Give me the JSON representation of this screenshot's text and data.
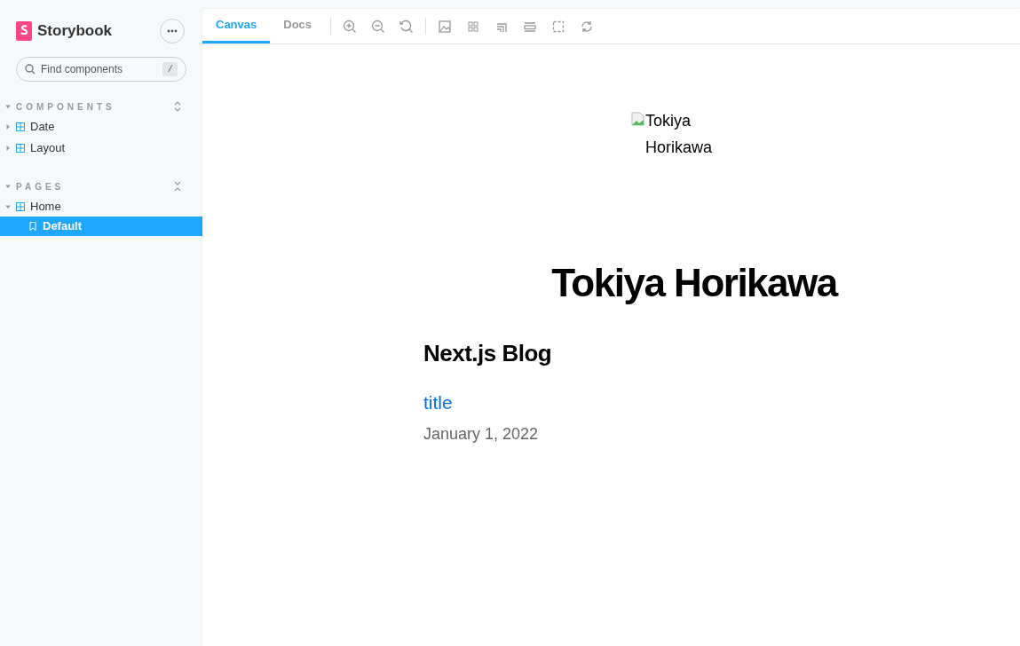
{
  "sidebar": {
    "brand": "Storybook",
    "search": {
      "placeholder": "Find components",
      "shortcut": "/"
    },
    "sections": [
      {
        "label": "COMPONENTS",
        "expanded": true,
        "items": [
          {
            "label": "Date",
            "expanded": false
          },
          {
            "label": "Layout",
            "expanded": false
          }
        ]
      },
      {
        "label": "PAGES",
        "expanded": true,
        "items": [
          {
            "label": "Home",
            "expanded": true,
            "children": [
              {
                "label": "Default",
                "selected": true
              }
            ]
          }
        ]
      }
    ]
  },
  "tabs": [
    {
      "label": "Canvas",
      "selected": true
    },
    {
      "label": "Docs",
      "selected": false
    }
  ],
  "preview": {
    "image_alt": "Tokiya Horikawa",
    "heading": "Tokiya Horikawa",
    "blog_title": "Next.js Blog",
    "post": {
      "title": "title",
      "date": "January 1, 2022"
    }
  }
}
